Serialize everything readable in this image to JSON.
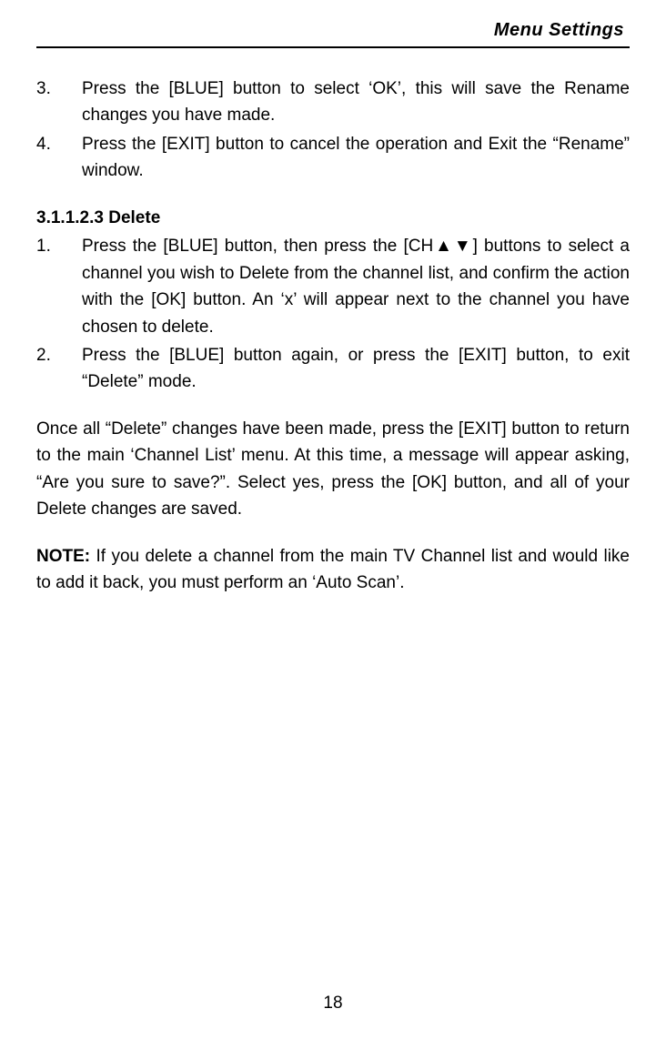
{
  "header": {
    "title": "Menu  Settings"
  },
  "rename": {
    "items": [
      {
        "n": "3.",
        "text": "Press the [BLUE] button to select ‘OK’, this will save the Rename changes you have made."
      },
      {
        "n": "4.",
        "text": "Press the [EXIT] button to cancel the operation and Exit the “Rename” window."
      }
    ]
  },
  "delete_section": {
    "heading": "3.1.1.2.3    Delete",
    "items": [
      {
        "n": "1.",
        "text": "Press the [BLUE] button, then press the [CH▲▼] buttons to select a channel you wish to Delete from the channel list, and confirm the action with the [OK] button.    An ‘x’ will appear next to the channel you have chosen to delete."
      },
      {
        "n": "2.",
        "text": "Press the [BLUE] button again, or press the [EXIT] button, to exit “Delete” mode."
      }
    ],
    "after": "Once all “Delete” changes have been made, press the [EXIT] button to return to the main ‘Channel List’ menu. At this time, a message will appear asking, “Are you sure to save?”.    Select yes, press the [OK] button, and all of your Delete changes are saved."
  },
  "note": {
    "label": "NOTE:",
    "text": "    If you delete a channel from the main TV Channel list and would like to add it back, you must perform an ‘Auto Scan’."
  },
  "page_number": "18"
}
